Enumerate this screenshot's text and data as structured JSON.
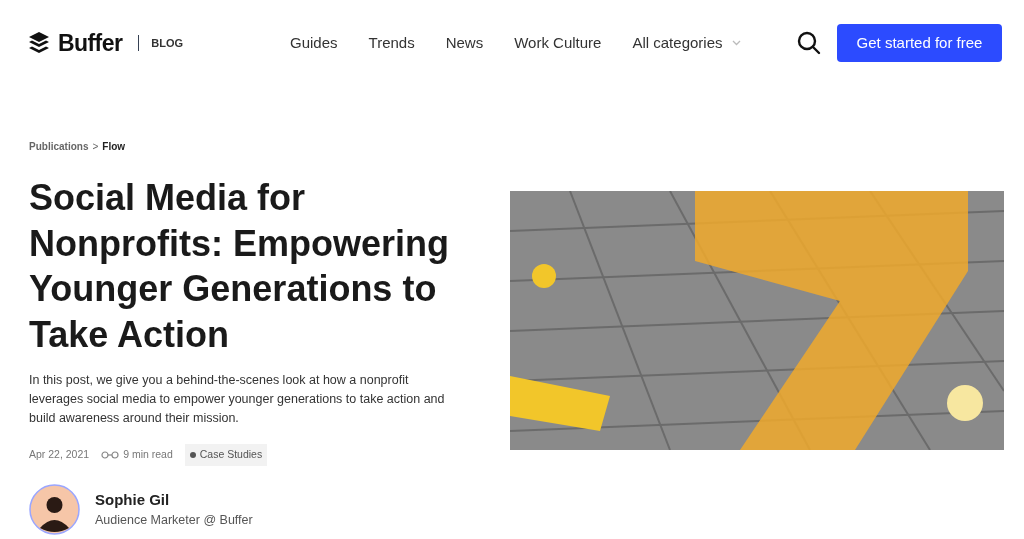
{
  "header": {
    "logo": "Buffer",
    "section": "BLOG",
    "nav": [
      {
        "label": "Guides",
        "kind": "link"
      },
      {
        "label": "Trends",
        "kind": "link"
      },
      {
        "label": "News",
        "kind": "link"
      },
      {
        "label": "Work Culture",
        "kind": "link"
      },
      {
        "label": "All categories",
        "kind": "dropdown"
      }
    ],
    "cta": "Get started for free"
  },
  "breadcrumb": [
    {
      "label": "Publications"
    },
    {
      "label": "Flow"
    }
  ],
  "breadcrumb_separator": ">",
  "article": {
    "title": "Social Media for Nonprofits: Empowering Younger Generations to Take Action",
    "summary": "In this post, we give you a behind-the-scenes look at how a nonprofit leverages social media to empower younger generations to take action and build awareness around their mission.",
    "date": "Apr 22, 2021",
    "read_time": "9 min read",
    "category": "Case Studies"
  },
  "author": {
    "name": "Sophie Gil",
    "role": "Audience Marketer @ Buffer"
  }
}
